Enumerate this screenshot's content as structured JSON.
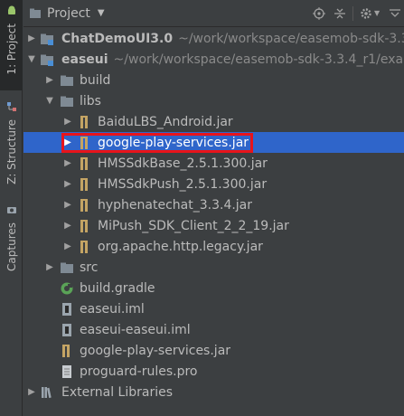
{
  "strip": {
    "tab_project": "1: Project",
    "tab_structure": "Z: Structure",
    "tab_captures": "Captures"
  },
  "header": {
    "title": "Project",
    "icons": [
      "project-icon",
      "dropdown-caret-icon",
      "target-icon",
      "collapse-icon",
      "settings-icon",
      "hide-icon"
    ]
  },
  "tree": [
    {
      "label": "ChatDemoUI3.0",
      "path": "~/work/workspace/easemob-sdk-3.3",
      "bold": true,
      "expanded": false,
      "icon": "module-folder-icon"
    },
    {
      "label": "easeui",
      "path": "~/work/workspace/easemob-sdk-3.3.4_r1/exa",
      "bold": true,
      "expanded": true,
      "icon": "module-folder-icon"
    },
    {
      "label": "build",
      "expanded": false,
      "icon": "folder-icon"
    },
    {
      "label": "libs",
      "expanded": true,
      "icon": "folder-icon"
    },
    {
      "label": "BaiduLBS_Android.jar",
      "expanded": false,
      "icon": "jar-icon"
    },
    {
      "label": "google-play-services.jar",
      "expanded": false,
      "icon": "jar-icon",
      "selected": true
    },
    {
      "label": "HMSSdkBase_2.5.1.300.jar",
      "expanded": false,
      "icon": "jar-icon"
    },
    {
      "label": "HMSSdkPush_2.5.1.300.jar",
      "expanded": false,
      "icon": "jar-icon"
    },
    {
      "label": "hyphenatechat_3.3.4.jar",
      "expanded": false,
      "icon": "jar-icon"
    },
    {
      "label": "MiPush_SDK_Client_2_2_19.jar",
      "expanded": false,
      "icon": "jar-icon"
    },
    {
      "label": "org.apache.http.legacy.jar",
      "expanded": false,
      "icon": "jar-icon"
    },
    {
      "label": "src",
      "expanded": false,
      "icon": "folder-icon"
    },
    {
      "label": "build.gradle",
      "icon": "gradle-icon"
    },
    {
      "label": "easeui.iml",
      "icon": "iml-file-icon"
    },
    {
      "label": "easeui-easeui.iml",
      "icon": "iml-file-icon"
    },
    {
      "label": "google-play-services.jar",
      "icon": "jar-icon"
    },
    {
      "label": "proguard-rules.pro",
      "icon": "text-file-icon"
    },
    {
      "label": "External Libraries",
      "expanded": false,
      "icon": "libraries-icon"
    }
  ],
  "colors": {
    "background": "#3c3f41",
    "selection": "#2f65ca",
    "highlight_box": "#e8141b",
    "folder": "#7f8a94",
    "jar": "#c4a464"
  }
}
